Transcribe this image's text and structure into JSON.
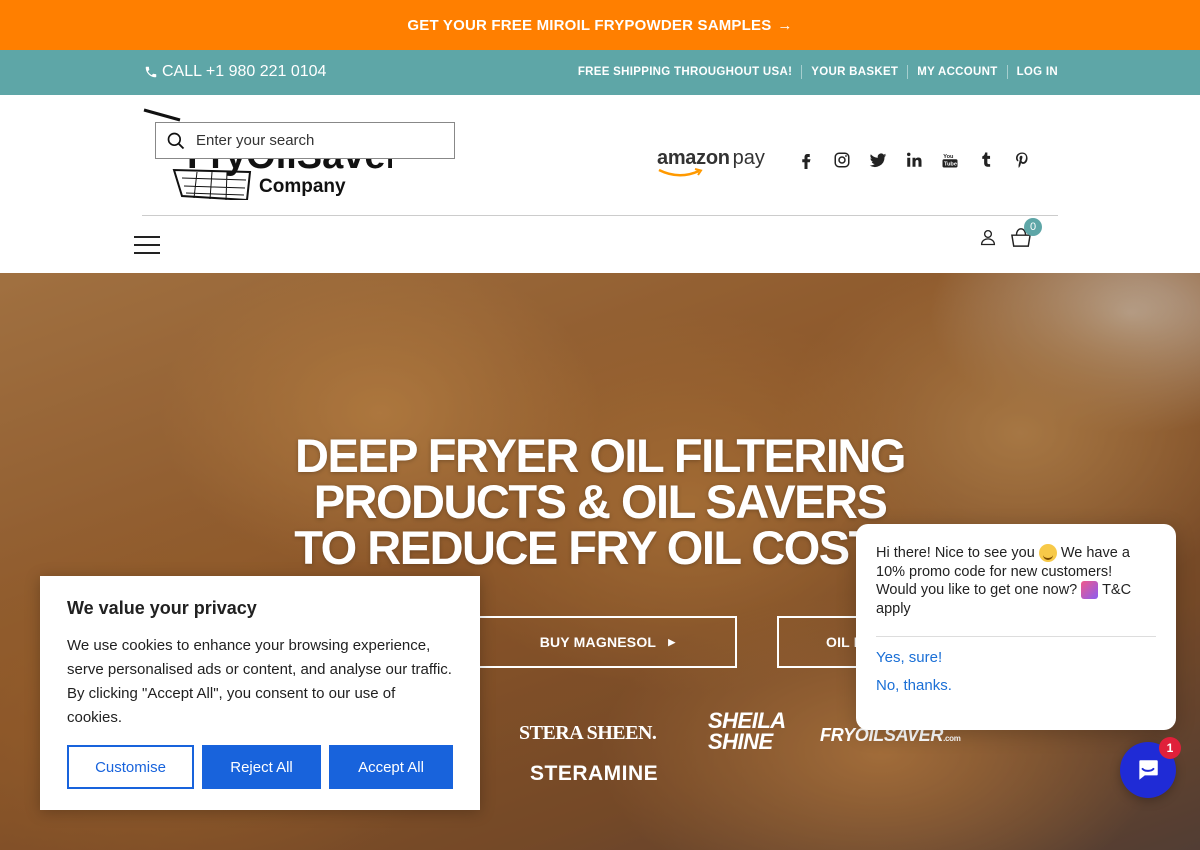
{
  "promo": {
    "text": "GET YOUR FREE MIROIL FRYPOWDER SAMPLES",
    "arrow": "→"
  },
  "topbar": {
    "phone": "CALL +1 980 221 0104",
    "links": [
      "FREE SHIPPING THROUGHOUT USA!",
      "YOUR BASKET",
      "MY ACCOUNT",
      "LOG IN"
    ]
  },
  "header": {
    "logo_line1": "FryOilSaver",
    "logo_line2": "Company",
    "search_placeholder": "Enter your search",
    "amazon_brand": "amazon",
    "amazon_pay": "pay",
    "socials": [
      "facebook-icon",
      "instagram-icon",
      "twitter-icon",
      "linkedin-icon",
      "youtube-icon",
      "tumblr-icon",
      "pinterest-icon"
    ],
    "basket_count": "0"
  },
  "hero": {
    "title_line1": "DEEP FRYER OIL FILTERING",
    "title_line2": "PRODUCTS & OIL SAVERS",
    "title_line3": "TO REDUCE FRY OIL COSTS",
    "button_magnesol": "BUY MAGNESOL",
    "button_oil": "OIL F",
    "brands": {
      "sterasheen": "STERA SHEEN.",
      "sheila_line1": "SHEILA",
      "sheila_line2": "SHINE",
      "fryoilsaver": "FRYOILSAVER",
      "fryoilsaver_suffix": ".com",
      "steramine": "STERAMINE"
    }
  },
  "cookie": {
    "title": "We value your privacy",
    "text": "We use cookies to enhance your browsing experience, serve personalised ads or content, and analyse our traffic. By clicking \"Accept All\", you consent to our use of cookies.",
    "customise": "Customise",
    "reject": "Reject All",
    "accept": "Accept All"
  },
  "chat": {
    "message_part1": "Hi there! Nice to see you",
    "message_part2": "We have a 10% promo code for new customers! Would you like to get one now?",
    "message_part3": "T&C apply",
    "yes": "Yes, sure!",
    "no": "No, thanks.",
    "badge": "1"
  },
  "colors": {
    "promo": "#ff7f00",
    "topbar": "#5ea6a7",
    "cookie_blue": "#1863dc",
    "chat_launcher": "#1f2bd6"
  }
}
